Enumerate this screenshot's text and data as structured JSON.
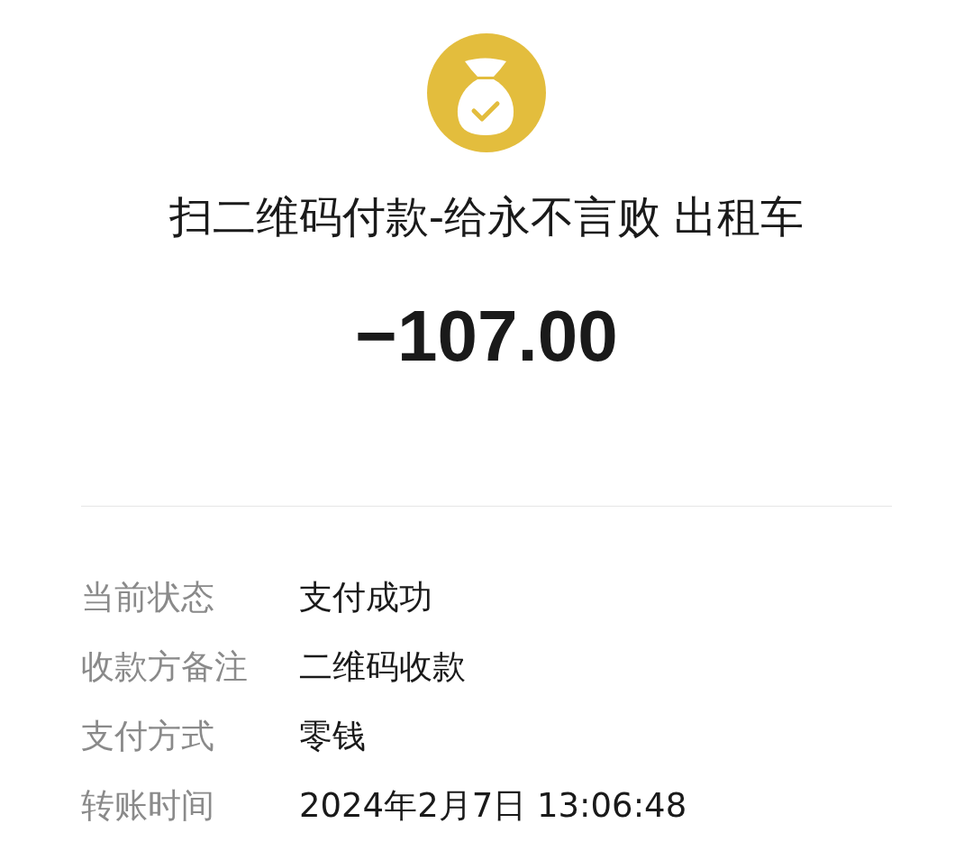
{
  "header": {
    "title": "扫二维码付款-给永不言败 出租车",
    "amount": "−107.00"
  },
  "details": [
    {
      "label": "当前状态",
      "value": "支付成功"
    },
    {
      "label": "收款方备注",
      "value": "二维码收款"
    },
    {
      "label": "支付方式",
      "value": "零钱"
    },
    {
      "label": "转账时间",
      "value": "2024年2月7日 13:06:48"
    }
  ]
}
